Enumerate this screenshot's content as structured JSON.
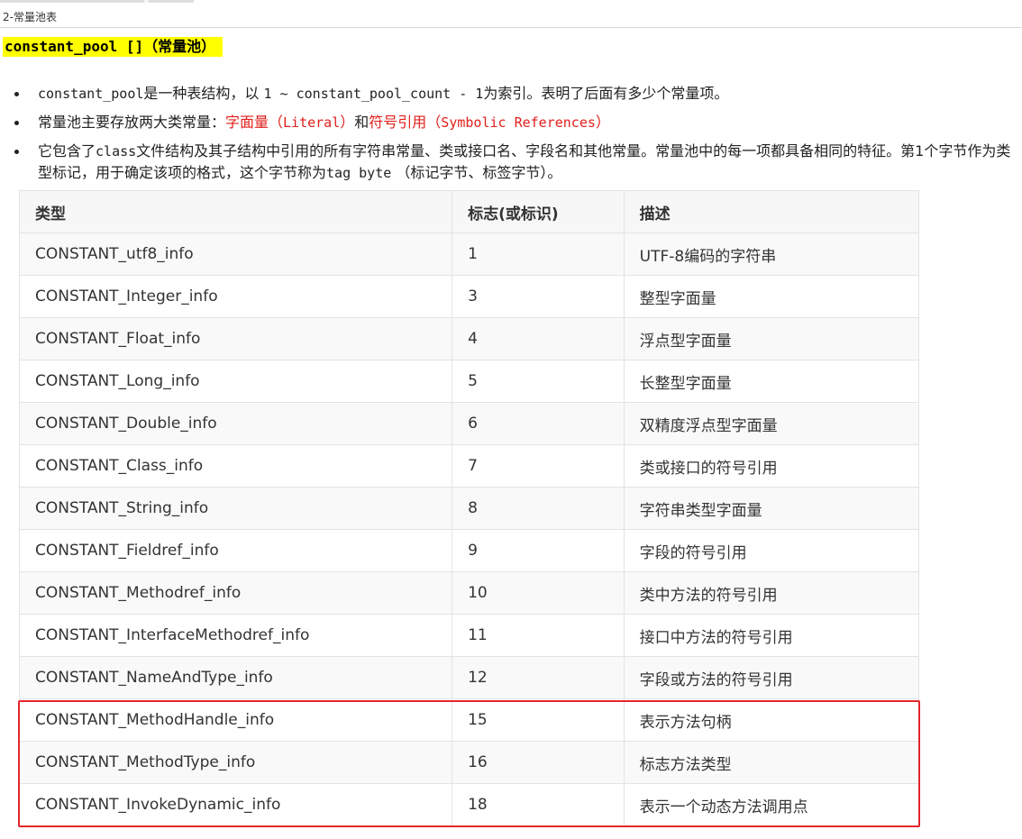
{
  "window": {
    "title": "2-常量池表"
  },
  "heading": "constant_pool []（常量池）",
  "bullets": [
    {
      "parts": [
        {
          "text": "constant_pool",
          "mono": true
        },
        {
          "text": "是一种表结构，以 "
        },
        {
          "text": "1 ~ constant_pool_count - 1",
          "mono": true
        },
        {
          "text": "为索引。表明了后面有多少个常量项。"
        }
      ]
    },
    {
      "parts": [
        {
          "text": "常量池主要存放两大类常量："
        },
        {
          "text": "字面量（",
          "red": true
        },
        {
          "text": "Literal",
          "red": true,
          "mono": true
        },
        {
          "text": "）",
          "red": true
        },
        {
          "text": "和"
        },
        {
          "text": "符号引用（",
          "red": true
        },
        {
          "text": "Symbolic References",
          "red": true,
          "mono": true
        },
        {
          "text": "）",
          "red": true
        }
      ]
    },
    {
      "parts": [
        {
          "text": "它包含了"
        },
        {
          "text": "class",
          "mono": true
        },
        {
          "text": "文件结构及其子结构中引用的所有字符串常量、类或接口名、字段名和其他常量。常量池中的每一项都具备相同的特征。第1个字节作为类型标记，用于确定该项的格式，这个字节称为"
        },
        {
          "text": "tag byte",
          "mono": true
        },
        {
          "text": " （标记字节、标签字节）。"
        }
      ]
    }
  ],
  "table": {
    "headers": [
      "类型",
      "标志(或标识)",
      "描述"
    ],
    "rows": [
      [
        "CONSTANT_utf8_info",
        "1",
        "UTF-8编码的字符串"
      ],
      [
        "CONSTANT_Integer_info",
        "3",
        "整型字面量"
      ],
      [
        "CONSTANT_Float_info",
        "4",
        "浮点型字面量"
      ],
      [
        "CONSTANT_Long_info",
        "5",
        "长整型字面量"
      ],
      [
        "CONSTANT_Double_info",
        "6",
        "双精度浮点型字面量"
      ],
      [
        "CONSTANT_Class_info",
        "7",
        "类或接口的符号引用"
      ],
      [
        "CONSTANT_String_info",
        "8",
        "字符串类型字面量"
      ],
      [
        "CONSTANT_Fieldref_info",
        "9",
        "字段的符号引用"
      ],
      [
        "CONSTANT_Methodref_info",
        "10",
        "类中方法的符号引用"
      ],
      [
        "CONSTANT_InterfaceMethodref_info",
        "11",
        "接口中方法的符号引用"
      ],
      [
        "CONSTANT_NameAndType_info",
        "12",
        "字段或方法的符号引用"
      ],
      [
        "CONSTANT_MethodHandle_info",
        "15",
        "表示方法句柄"
      ],
      [
        "CONSTANT_MethodType_info",
        "16",
        "标志方法类型"
      ],
      [
        "CONSTANT_InvokeDynamic_info",
        "18",
        "表示一个动态方法调用点"
      ]
    ]
  },
  "colors": {
    "heading_highlight": "#ffff00",
    "red_text": "#e0201c",
    "annotation_box": "#e3262c"
  }
}
